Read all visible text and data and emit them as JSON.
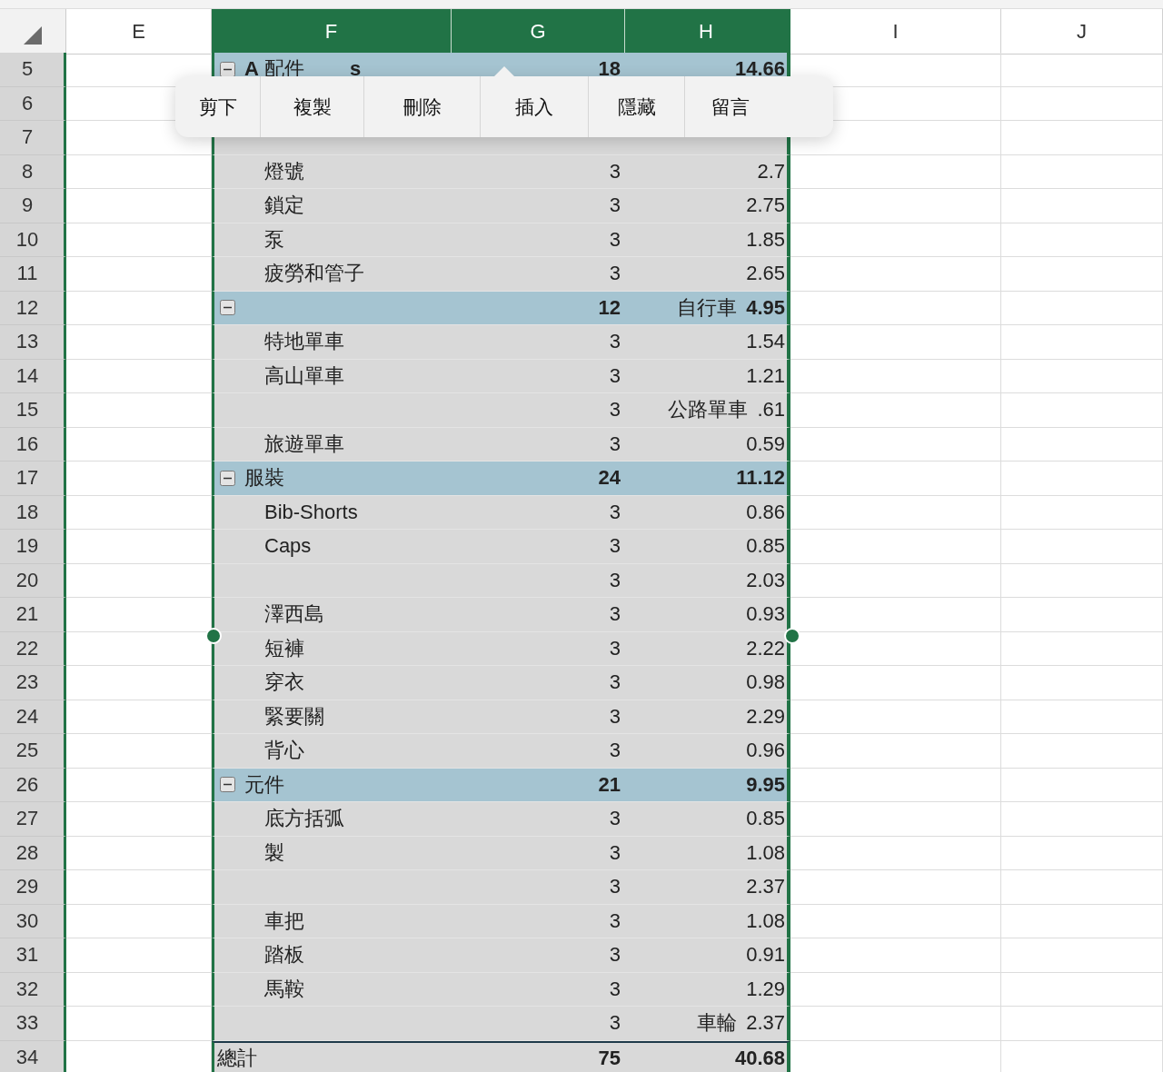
{
  "columns": [
    {
      "label": "E",
      "selected": false
    },
    {
      "label": "F",
      "selected": true
    },
    {
      "label": "G",
      "selected": true
    },
    {
      "label": "H",
      "selected": true
    },
    {
      "label": "I",
      "selected": false
    },
    {
      "label": "J",
      "selected": false
    }
  ],
  "rows": [
    {
      "number": "5",
      "kind": "group",
      "expanded": true,
      "label": "**A** 配件",
      "label_tail": "s",
      "count": "18",
      "total": "14.66"
    },
    {
      "number": "6",
      "kind": "covered"
    },
    {
      "number": "7",
      "kind": "blank"
    },
    {
      "number": "8",
      "kind": "item",
      "label": "燈號",
      "count": "3",
      "total": "2.7"
    },
    {
      "number": "9",
      "kind": "item",
      "label": "鎖定",
      "count": "3",
      "total": "2.75"
    },
    {
      "number": "10",
      "kind": "item",
      "label": "泵",
      "count": "3",
      "total": "1.85"
    },
    {
      "number": "11",
      "kind": "item",
      "label": "疲勞和管子",
      "count": "3",
      "total": "2.65"
    },
    {
      "number": "12",
      "kind": "group",
      "expanded": true,
      "count": "12",
      "note": "自行車",
      "total": "4.95"
    },
    {
      "number": "13",
      "kind": "item",
      "label": "特地單車",
      "count": "3",
      "total": "1.54"
    },
    {
      "number": "14",
      "kind": "item",
      "label": "高山單車",
      "count": "3",
      "total": "1.21"
    },
    {
      "number": "15",
      "kind": "item",
      "count": "3",
      "note": "公路單車",
      "total": ".61"
    },
    {
      "number": "16",
      "kind": "item",
      "label": "旅遊單車",
      "count": "3",
      "total": "0.59"
    },
    {
      "number": "17",
      "kind": "group",
      "expanded": true,
      "label": "服裝",
      "count": "24",
      "total": "11.12"
    },
    {
      "number": "18",
      "kind": "item",
      "label": "Bib-Shorts",
      "count": "3",
      "total": "0.86"
    },
    {
      "number": "19",
      "kind": "item",
      "label": "Caps",
      "count": "3",
      "total": "0.85"
    },
    {
      "number": "20",
      "kind": "item",
      "count": "3",
      "total": "2.03"
    },
    {
      "number": "21",
      "kind": "item",
      "label": "澤西島",
      "count": "3",
      "total": "0.93"
    },
    {
      "number": "22",
      "kind": "item",
      "label": "短褲",
      "count": "3",
      "total": "2.22"
    },
    {
      "number": "23",
      "kind": "item",
      "label": "穿衣",
      "count": "3",
      "total": "0.98"
    },
    {
      "number": "24",
      "kind": "item",
      "label": "緊要關",
      "count": "3",
      "total": "2.29"
    },
    {
      "number": "25",
      "kind": "item",
      "label": "背心",
      "count": "3",
      "total": "0.96"
    },
    {
      "number": "26",
      "kind": "group",
      "expanded": true,
      "label": "元件",
      "count": "21",
      "total": "9.95"
    },
    {
      "number": "27",
      "kind": "item",
      "label": "底方括弧",
      "count": "3",
      "total": "0.85"
    },
    {
      "number": "28",
      "kind": "item",
      "label": "製",
      "count": "3",
      "total": "1.08"
    },
    {
      "number": "29",
      "kind": "item",
      "count": "3",
      "total": "2.37"
    },
    {
      "number": "30",
      "kind": "item",
      "label": "車把",
      "count": "3",
      "total": "1.08"
    },
    {
      "number": "31",
      "kind": "item",
      "label": "踏板",
      "count": "3",
      "total": "0.91"
    },
    {
      "number": "32",
      "kind": "item",
      "label": "馬鞍",
      "count": "3",
      "total": "1.29"
    },
    {
      "number": "33",
      "kind": "item",
      "count": "3",
      "note": "車輪",
      "total": "2.37"
    },
    {
      "number": "34",
      "kind": "total",
      "label": "總計",
      "count": "75",
      "total": "40.68"
    }
  ],
  "context_menu": [
    "剪下",
    "複製",
    "刪除",
    "插入",
    "隱藏",
    "留言"
  ]
}
